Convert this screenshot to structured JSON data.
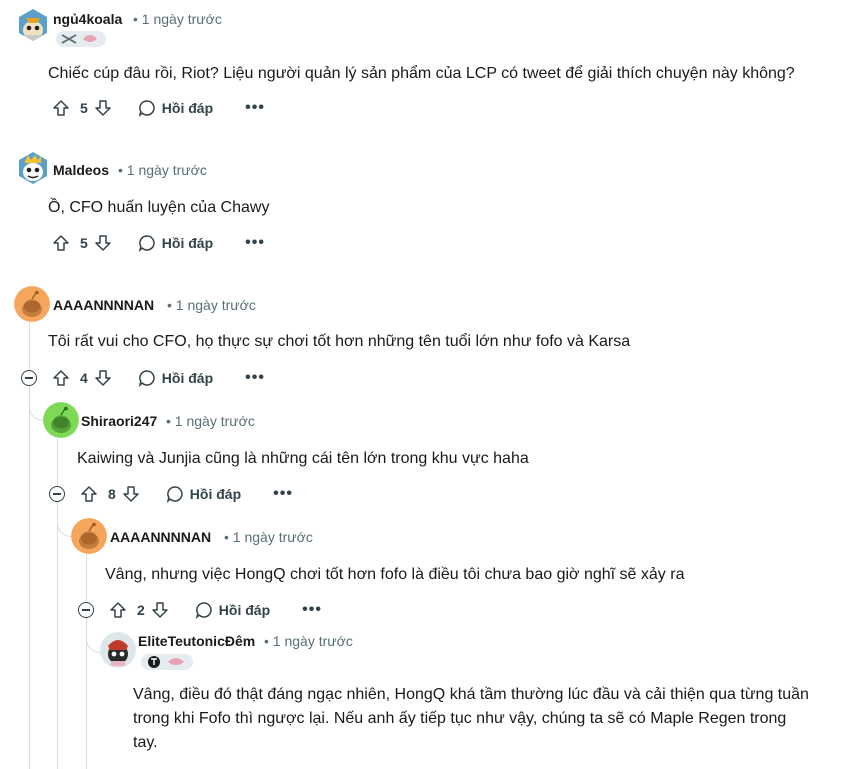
{
  "comments": [
    {
      "username": "ngủ4koala",
      "time": "• 1 ngày trước",
      "text": "Chiếc cúp đâu rồi, Riot? Liệu người quản lý sản phẩm của LCP có tweet để giải thích chuyện này không?",
      "votes": "5",
      "reply": "Hồi đáp",
      "more": "•••"
    },
    {
      "username": "Maldeos",
      "time": "• 1 ngày trước",
      "text": "Ồ, CFO huấn luyện của Chawy",
      "votes": "5",
      "reply": "Hồi đáp",
      "more": "•••"
    },
    {
      "username": "AAAANNNNAN",
      "time": "• 1 ngày trước",
      "text": "Tôi rất vui cho CFO, họ thực sự chơi tốt hơn những tên tuổi lớn như fofo và Karsa",
      "votes": "4",
      "reply": "Hồi đáp",
      "more": "•••"
    },
    {
      "username": "Shiraori247",
      "time": "• 1 ngày trước",
      "text": "Kaiwing và Junjia cũng là những cái tên lớn trong khu vực haha",
      "votes": "8",
      "reply": "Hồi đáp",
      "more": "•••"
    },
    {
      "username": "AAAANNNNAN",
      "time": "• 1 ngày trước",
      "text": "Vâng, nhưng việc HongQ chơi tốt hơn fofo là điều tôi chưa bao giờ nghĩ sẽ xảy ra",
      "votes": "2",
      "reply": "Hồi đáp",
      "more": "•••"
    },
    {
      "username": "EliteTeutonicĐêm",
      "time": "• 1 ngày trước",
      "text_lines": [
        "Vâng, điều đó thật đáng ngạc nhiên, HongQ khá tầm thường lúc đầu và cải thiện qua từng tuần",
        "trong khi Fofo thì ngược lại. Nếu anh ấy tiếp tục như vậy, chúng ta sẽ có Maple Regen trong",
        "tay."
      ]
    }
  ],
  "colors": {
    "avatar_orange": "#f5a65b",
    "avatar_green": "#7ed957",
    "thread_line": "#d6dee1",
    "meta_text": "#576f76"
  }
}
